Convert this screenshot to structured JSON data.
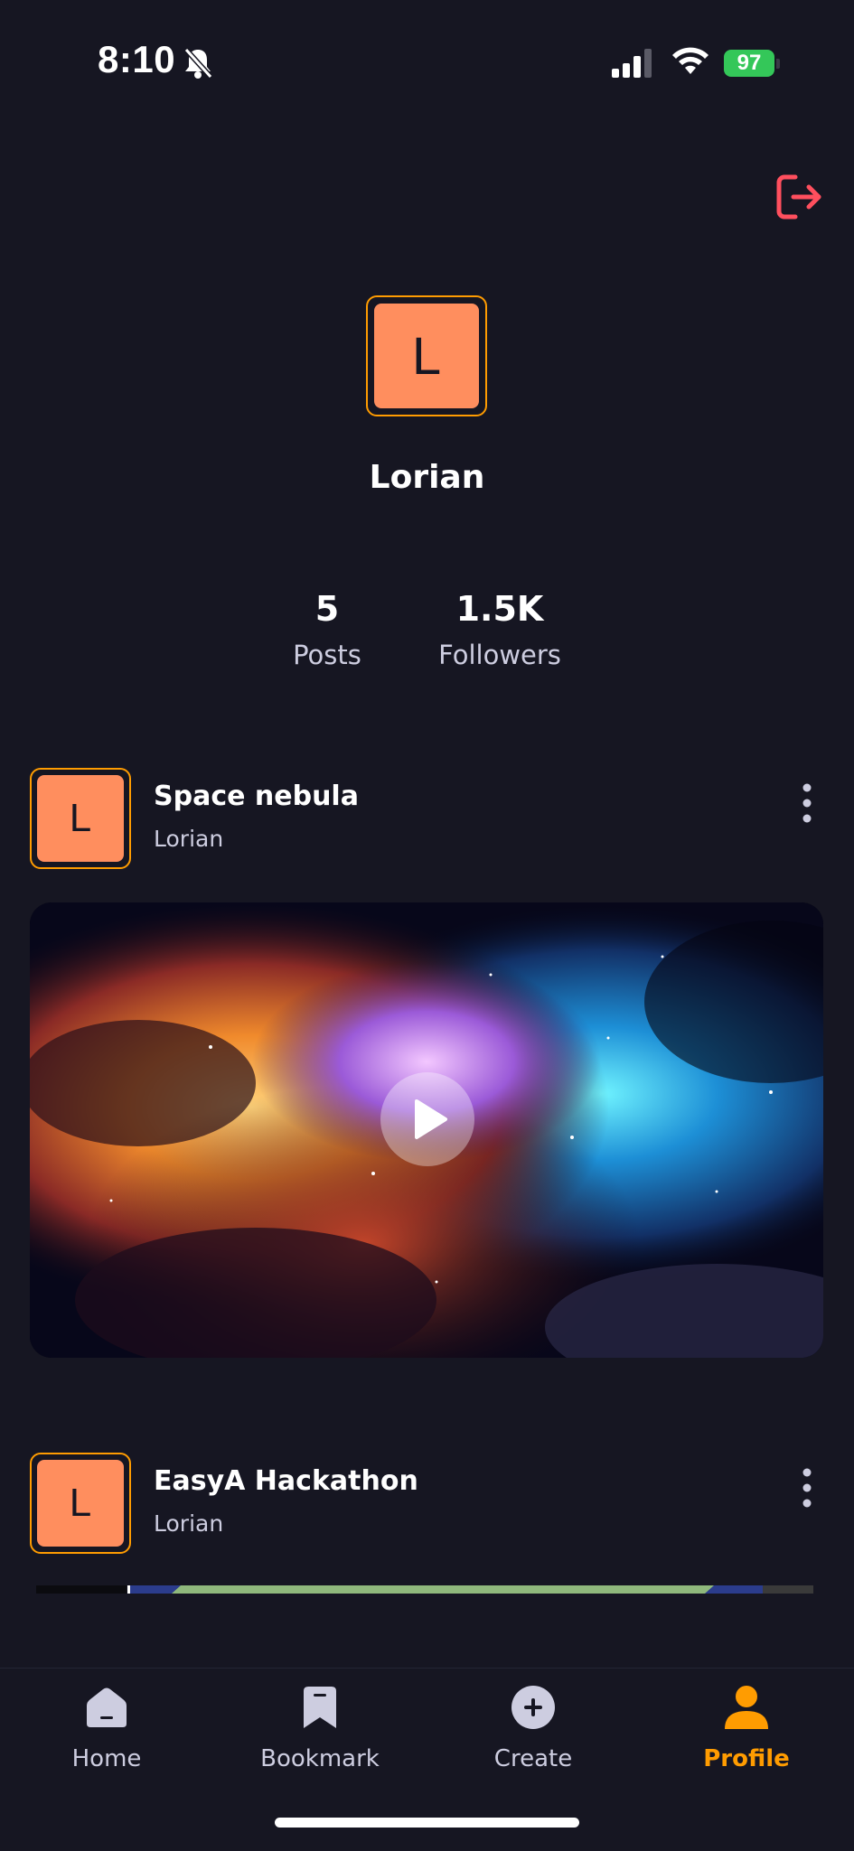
{
  "status_bar": {
    "time": "8:10",
    "battery": "97",
    "icons": [
      "bell-slash-icon",
      "cellular-signal-icon",
      "wifi-icon",
      "battery-icon"
    ]
  },
  "header": {
    "logout_icon": "logout-icon"
  },
  "profile": {
    "avatar_initial": "L",
    "username": "Lorian",
    "stats": {
      "posts_count": "5",
      "posts_label": "Posts",
      "followers_count": "1.5K",
      "followers_label": "Followers"
    }
  },
  "posts": [
    {
      "avatar_initial": "L",
      "title": "Space nebula",
      "author": "Lorian",
      "thumbnail_icon": "play-icon"
    },
    {
      "avatar_initial": "L",
      "title": "EasyA Hackathon",
      "author": "Lorian"
    }
  ],
  "tab_bar": {
    "tabs": [
      {
        "label": "Home",
        "icon": "home-icon"
      },
      {
        "label": "Bookmark",
        "icon": "bookmark-icon"
      },
      {
        "label": "Create",
        "icon": "plus-circle-icon"
      },
      {
        "label": "Profile",
        "icon": "profile-icon"
      }
    ],
    "active_tab": "Profile"
  },
  "colors": {
    "background": "#161622",
    "accent": "#ff9c01",
    "avatar_fill": "#ff8e5e",
    "logout": "#ff4f5e",
    "muted_text": "#cdcde0",
    "battery": "#34c759"
  }
}
